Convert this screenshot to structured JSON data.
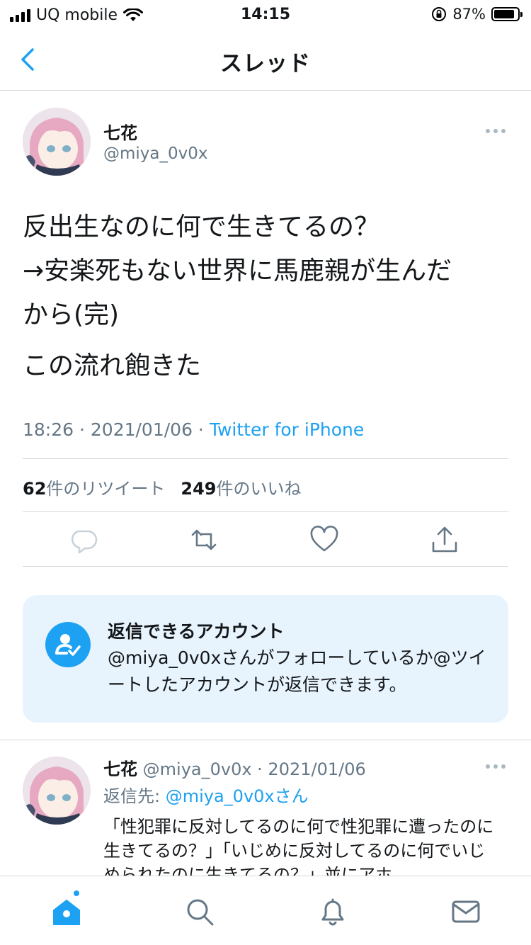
{
  "status_bar": {
    "carrier": "UQ mobile",
    "time": "14:15",
    "battery": "87%",
    "battery_level": 0.87
  },
  "nav": {
    "title": "スレッド"
  },
  "tweet": {
    "name": "七花",
    "handle": "@miya_0v0x",
    "lines": [
      "反出生なのに何で生きてるの？",
      "→安楽死もない世界に馬鹿親が生んだ",
      "から(完)"
    ],
    "line2": "この流れ飽きた",
    "timestamp": "18:26 · 2021/01/06 · ",
    "source": "Twitter for iPhone",
    "retweet_count": "62",
    "retweet_label": "件のリツイート",
    "like_count": "249",
    "like_label": "件のいいね"
  },
  "restriction_card": {
    "title": "返信できるアカウント",
    "text": "@miya_0v0xさんがフォローしているか@ツイートしたアカウントが返信できます。"
  },
  "reply": {
    "name": "七花",
    "handle_date": "@miya_0v0x · 2021/01/06",
    "reply_to_label": "返信先: ",
    "reply_to_handle": "@miya_0v0xさん",
    "body": "「性犯罪に反対してるのに何で性犯罪に遭ったのに生きてるの？」「いじめに反対してるのに何でいじめられたのに生きてるの？」並にアホ"
  },
  "colors": {
    "accent": "#1da1f2",
    "muted": "#657786",
    "card_bg": "#e8f4fd"
  },
  "icons": [
    "back-icon",
    "more-icon",
    "reply-icon",
    "retweet-icon",
    "like-icon",
    "share-icon",
    "reply-restriction-icon",
    "home-icon",
    "search-icon",
    "notifications-icon",
    "messages-icon"
  ]
}
